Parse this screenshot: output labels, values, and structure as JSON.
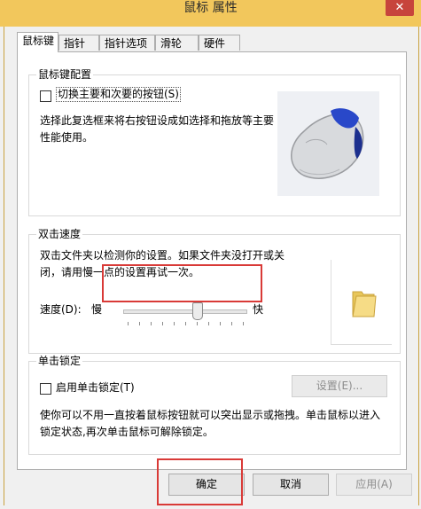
{
  "window": {
    "title": "鼠标 属性",
    "close_glyph": "✕"
  },
  "tabs": [
    {
      "label": "鼠标键",
      "active": true
    },
    {
      "label": "指针",
      "active": false
    },
    {
      "label": "指针选项",
      "active": false
    },
    {
      "label": "滑轮",
      "active": false
    },
    {
      "label": "硬件",
      "active": false
    }
  ],
  "button_config": {
    "title": "鼠标键配置",
    "switch_label": "切换主要和次要的按钮(S)",
    "switch_checked": false,
    "description": "选择此复选框来将右按钮设成如选择和拖放等主要性能使用。"
  },
  "double_click": {
    "title": "双击速度",
    "description": "双击文件夹以检测你的设置。如果文件夹没打开或关闭，请用慢一点的设置再试一次。",
    "speed_label": "速度(D):",
    "slow": "慢",
    "fast": "快",
    "speed_value": 0.6,
    "test_icon": "folder-icon"
  },
  "click_lock": {
    "title": "单击锁定",
    "enable_label": "启用单击锁定(T)",
    "enable_checked": false,
    "settings_button": "设置(E)...",
    "description": "使你可以不用一直按着鼠标按钮就可以突出显示或拖拽。单击鼠标以进入锁定状态,再次单击鼠标可解除锁定。"
  },
  "footer": {
    "ok": "确定",
    "cancel": "取消",
    "apply": "应用(A)"
  },
  "colors": {
    "titlebar": "#f2c75c",
    "close": "#c7443c",
    "highlight": "#d93a37"
  }
}
